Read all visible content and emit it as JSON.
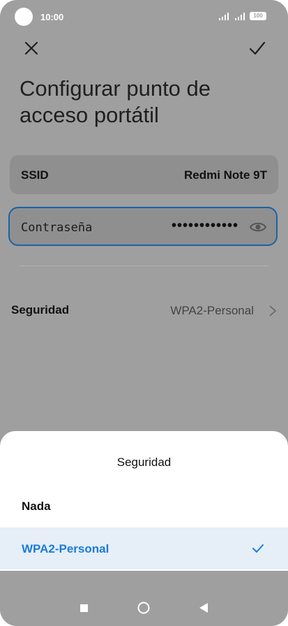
{
  "status": {
    "time": "10:00",
    "battery": "100"
  },
  "header": {
    "title": "Configurar punto de acceso portátil"
  },
  "ssid": {
    "label": "SSID",
    "value": "Redmi Note 9T"
  },
  "password": {
    "label": "Contraseña",
    "masked": "••••••••••••"
  },
  "security": {
    "label": "Seguridad",
    "value": "WPA2-Personal"
  },
  "sheet": {
    "title": "Seguridad",
    "options": [
      {
        "label": "Nada",
        "selected": false
      },
      {
        "label": "WPA2-Personal",
        "selected": true
      }
    ]
  },
  "colors": {
    "accent": "#1a7cd9",
    "selected_bg": "#e6eef7",
    "focus_border": "#1a63a8",
    "overlay": "#9f9f9f"
  },
  "icons": {
    "close": "close-icon",
    "confirm": "check-icon",
    "eye": "eye-icon",
    "chevron": "chevron-right-icon"
  }
}
